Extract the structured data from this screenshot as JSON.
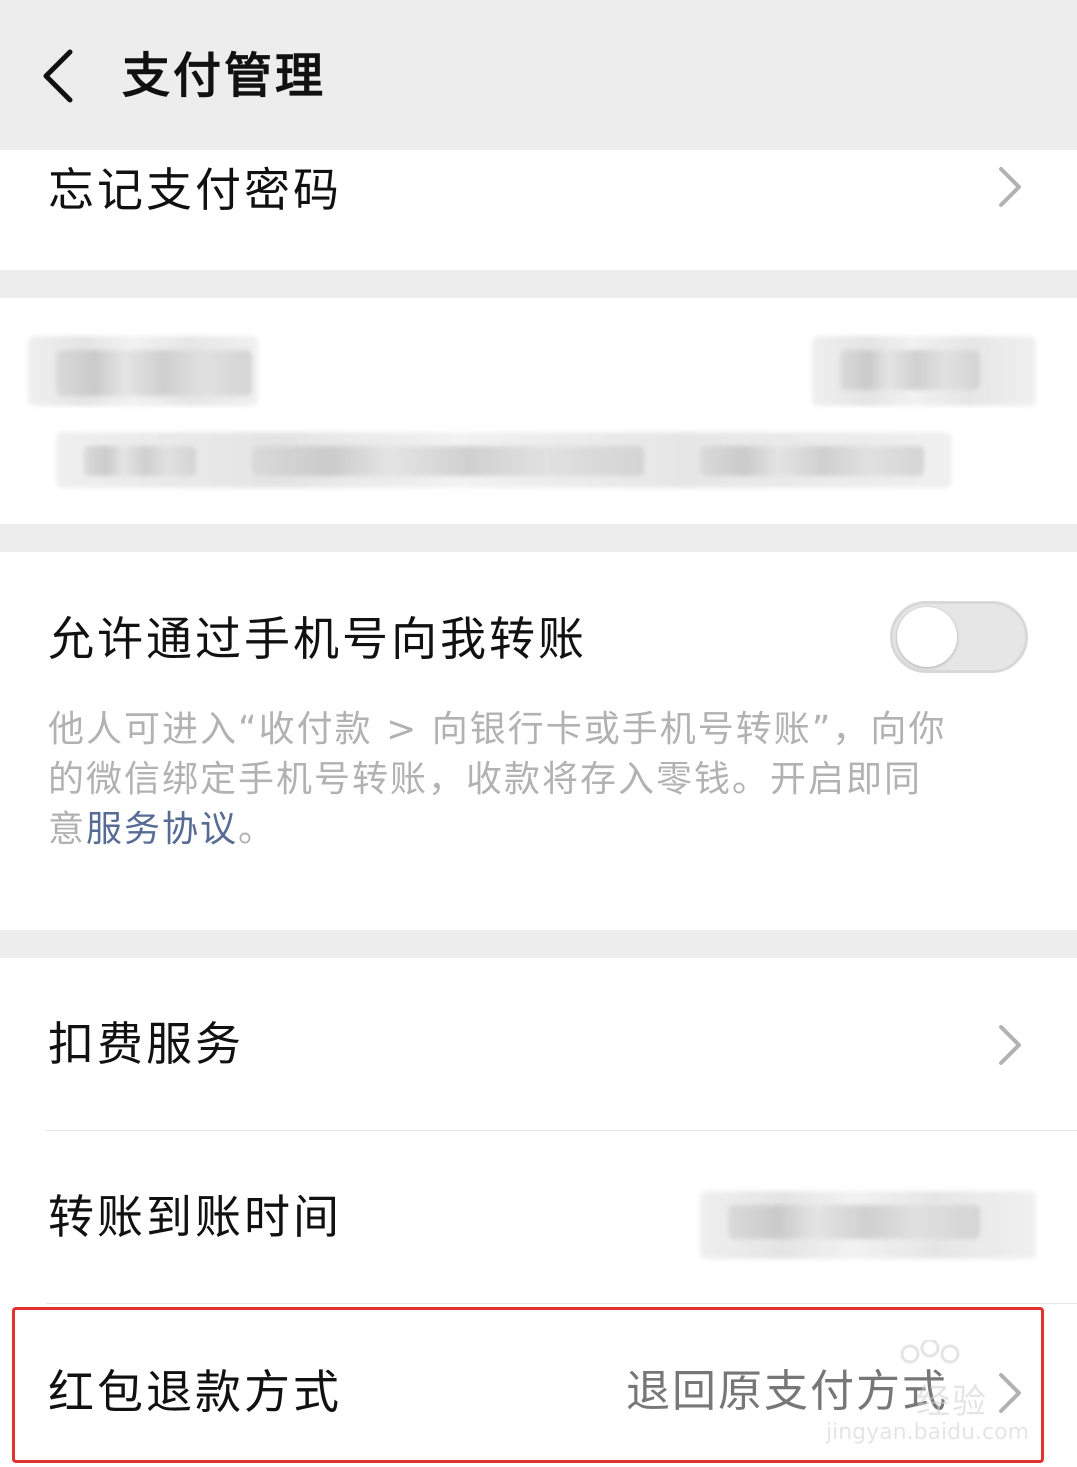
{
  "header": {
    "title": "支付管理"
  },
  "forgot_password": {
    "label": "忘记支付密码"
  },
  "transfer_by_phone": {
    "label": "允许通过手机号向我转账",
    "enabled": false,
    "description": "他人可进入“收付款 > 向银行卡或手机号转账”，向你的微信绑定手机号转账，收款将存入零钱。开启即同意",
    "link_text": "服务协议",
    "description_end": "。"
  },
  "deduction_services": {
    "label": "扣费服务"
  },
  "transfer_arrival_time": {
    "label": "转账到账时间"
  },
  "red_packet_refund": {
    "label": "红包退款方式",
    "value": "退回原支付方式"
  },
  "watermark": {
    "brand": "经验",
    "url": "jingyan.baidu.com"
  },
  "colors": {
    "background": "#ededed",
    "link": "#576b95",
    "highlight": "#e0312c"
  }
}
